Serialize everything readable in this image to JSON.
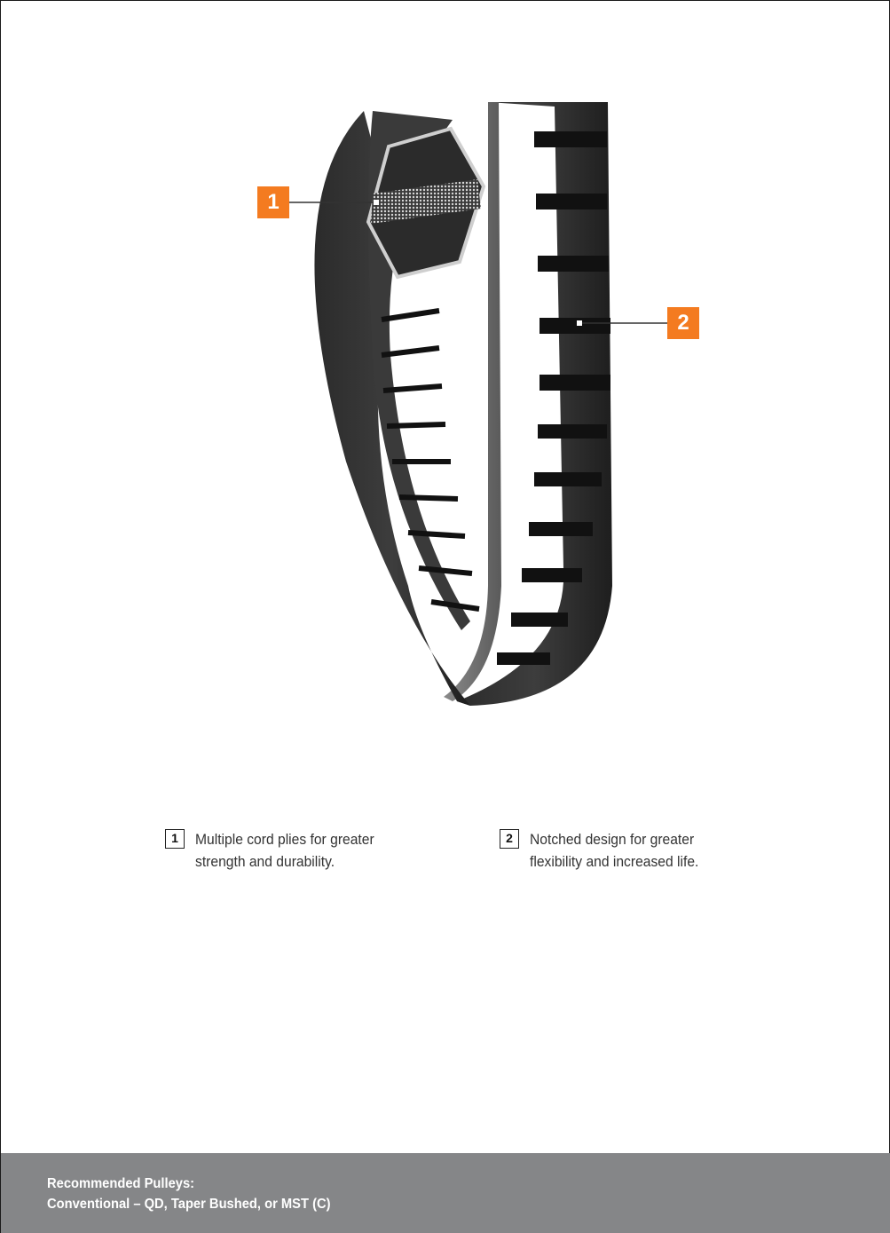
{
  "callouts": [
    {
      "number": "1",
      "text": "Multiple cord plies for greater strength and durability."
    },
    {
      "number": "2",
      "text": "Notched design for greater flexibility and increased life."
    }
  ],
  "footer": {
    "line1": "Recommended Pulleys:",
    "line2": "Conventional – QD, Taper Bushed, or MST (C)"
  },
  "colors": {
    "accent": "#f47b20",
    "footer_band": "#858688"
  }
}
